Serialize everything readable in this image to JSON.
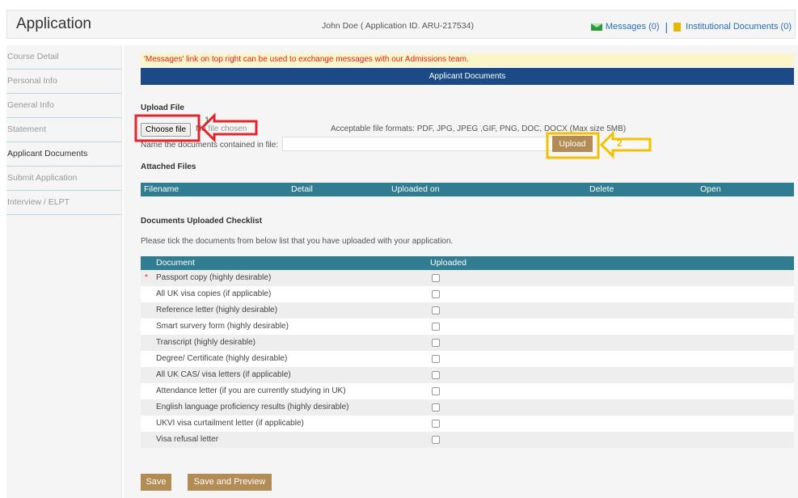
{
  "header": {
    "title": "Application",
    "applicant": "John Doe ( Application ID. ARU-217534)",
    "messages_label": "Messages (0)",
    "inst_docs_label": "Institutional Documents (0)",
    "separator": "|"
  },
  "sidebar": {
    "items": [
      {
        "label": "Course Detail"
      },
      {
        "label": "Personal Info"
      },
      {
        "label": "General Info"
      },
      {
        "label": "Statement"
      },
      {
        "label": "Applicant Documents"
      },
      {
        "label": "Submit Application"
      },
      {
        "label": "Interview / ELPT"
      }
    ]
  },
  "main": {
    "notice": "'Messages' link on top right can be used to exchange messages with our Admissions team.",
    "section_title": "Applicant Documents",
    "upload_file_heading": "Upload File",
    "choose_file_label": "Choose file",
    "no_file_text": "No file chosen",
    "formats_text": "Acceptable file formats: PDF, JPG, JPEG ,GIF, PNG, DOC, DOCX (Max size 5MB)",
    "name_label": "Name the documents contained in file:",
    "name_value": "",
    "upload_label": "Upload",
    "attached_heading": "Attached Files",
    "attached_columns": [
      "Filename",
      "Detail",
      "Uploaded on",
      "Delete",
      "Open"
    ],
    "checklist_heading": "Documents Uploaded Checklist",
    "checklist_help": "Please tick the documents from below list that you have uploaded with your application.",
    "checklist_columns": [
      "Document",
      "Uploaded"
    ],
    "checklist": [
      {
        "label": "Passport copy (highly desirable)",
        "required": true,
        "checked": false
      },
      {
        "label": "All UK visa copies (if applicable)",
        "required": false,
        "checked": false
      },
      {
        "label": "Reference letter (highly desirable)",
        "required": false,
        "checked": false
      },
      {
        "label": "Smart survery form (highly desirable)",
        "required": false,
        "checked": false
      },
      {
        "label": "Transcript (highly desirable)",
        "required": false,
        "checked": false
      },
      {
        "label": "Degree/ Certificate (highly desirable)",
        "required": false,
        "checked": false
      },
      {
        "label": "All UK CAS/ visa letters (if applicable)",
        "required": false,
        "checked": false
      },
      {
        "label": "Attendance letter (if you are currently studying in UK)",
        "required": false,
        "checked": false
      },
      {
        "label": "English language proficiency results (highly desirable)",
        "required": false,
        "checked": false
      },
      {
        "label": "UKVI visa curtailment letter (if applicable)",
        "required": false,
        "checked": false
      },
      {
        "label": "Visa refusal letter",
        "required": false,
        "checked": false
      }
    ],
    "required_marker": "*",
    "save_label": "Save",
    "save_preview_label": "Save and Preview"
  },
  "annotations": {
    "marker1": "1",
    "marker2": "2",
    "color1": "#e3262b",
    "color2": "#f2c200"
  },
  "colors": {
    "brand_navy": "#1b4a86",
    "teal_header": "#307d91",
    "button_tan": "#b38b54",
    "notice_bg": "#fbf6c9",
    "link_blue": "#2a6db5"
  }
}
